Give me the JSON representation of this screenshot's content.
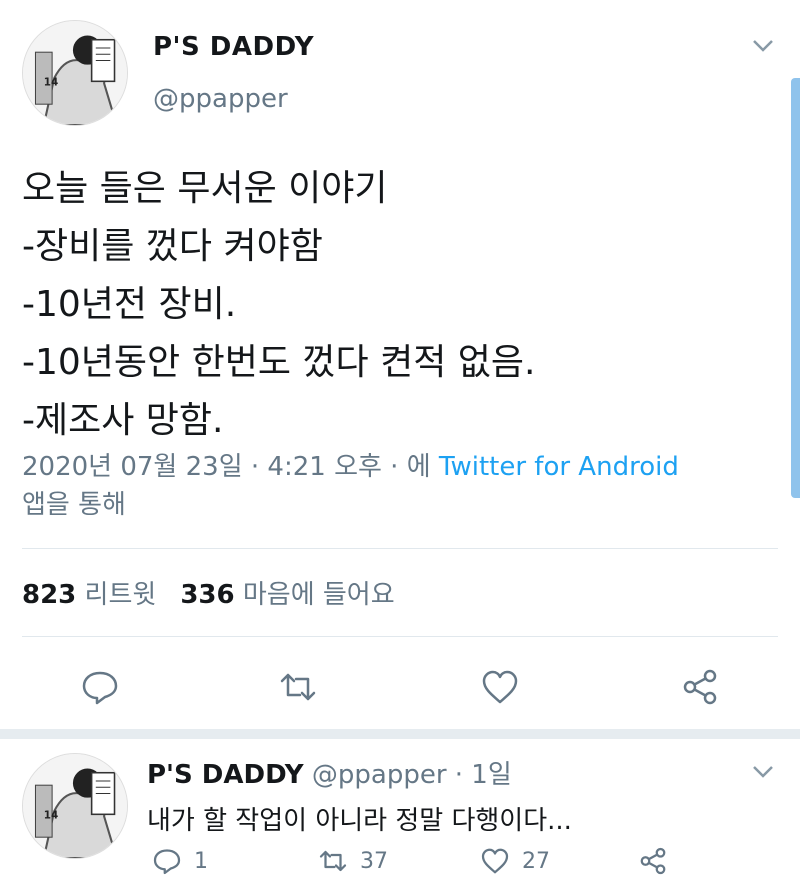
{
  "tweet": {
    "author_name": "P'S DADDY",
    "handle": "@ppapper",
    "lines": [
      "오늘 들은 무서운 이야기",
      "-장비를 껐다 켜야함",
      "-10년전 장비.",
      "-10년동안 한번도 껐다 켠적 없음.",
      "-제조사 망함."
    ],
    "timestamp": "2020년 07월 23일 · 4:21 오후 · 에 ",
    "source": "Twitter for Android",
    "source_suffix": "앱을 통해",
    "retweet_count": "823",
    "retweet_label": "리트윗",
    "like_count": "336",
    "like_label": "마음에 들어요"
  },
  "reply": {
    "author_name": "P'S DADDY",
    "handle": "@ppapper",
    "time": " · 1일",
    "text": "내가 할 작업이 아니라 정말 다행이다...",
    "reply_count": "1",
    "retweet_count": "37",
    "like_count": "27"
  },
  "icons": [
    "chevron-down-icon",
    "reply-icon",
    "retweet-icon",
    "like-icon",
    "share-icon"
  ],
  "colors": {
    "link": "#1da1f2",
    "muted": "#657786",
    "text": "#14171a",
    "scrollbar": "#8fc3ec"
  }
}
